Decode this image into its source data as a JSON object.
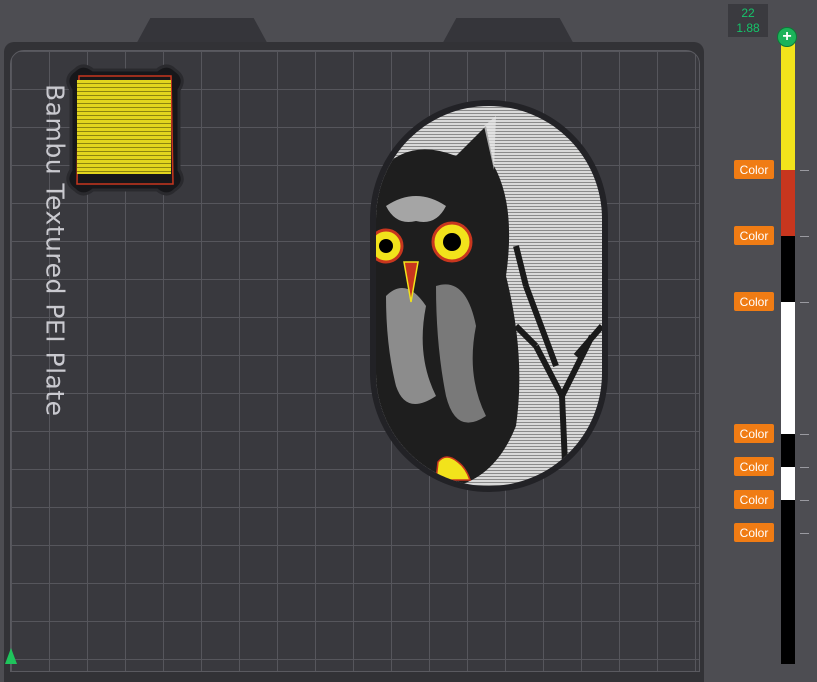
{
  "plate": {
    "label": "Bambu Textured PEI Plate",
    "colors": {
      "plate": "#323236",
      "grid": "#56565c",
      "background": "#4d4d52"
    }
  },
  "layer_readout": {
    "layer": "22",
    "height": "1.88"
  },
  "slider": {
    "handle_icon": "plus-icon",
    "handle_color": "#1cb35a",
    "segments": [
      {
        "color": "#f2e31b"
      },
      {
        "color": "#c8361e"
      },
      {
        "color": "#000000"
      },
      {
        "color": "#ffffff"
      },
      {
        "color": "#000000"
      },
      {
        "color": "#ffffff"
      },
      {
        "color": "#000000"
      }
    ]
  },
  "color_buttons": [
    "Color",
    "Color",
    "Color",
    "Color",
    "Color",
    "Color",
    "Color"
  ],
  "accent_color": "#f07c14",
  "models": [
    {
      "name": "calibration-cube",
      "color": "#e3d51e"
    },
    {
      "name": "owl-relief",
      "colors": [
        "#1a1a1a",
        "#ffffff",
        "#f2e31b",
        "#c8361e"
      ]
    }
  ]
}
